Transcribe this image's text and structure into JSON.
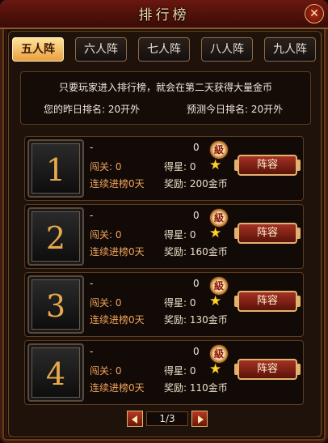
{
  "title": "排行榜",
  "close_label": "✕",
  "tabs": [
    {
      "label": "五人阵",
      "active": true
    },
    {
      "label": "六人阵",
      "active": false
    },
    {
      "label": "七人阵",
      "active": false
    },
    {
      "label": "八人阵",
      "active": false
    },
    {
      "label": "九人阵",
      "active": false
    }
  ],
  "info": {
    "notice": "只要玩家进入排行榜，就会在第二天获得大量金币",
    "yesterday_rank": "您的昨日排名: 20开外",
    "today_predict": "预测今日排名: 20开外"
  },
  "rows": [
    {
      "rank": "1",
      "name": "-",
      "level_value": "0",
      "level_badge": "級",
      "pass": "闯关: 0",
      "stars": "得星: 0",
      "streak": "连续进榜0天",
      "reward": "奖励: 200金币",
      "button": "阵容"
    },
    {
      "rank": "2",
      "name": "-",
      "level_value": "0",
      "level_badge": "級",
      "pass": "闯关: 0",
      "stars": "得星: 0",
      "streak": "连续进榜0天",
      "reward": "奖励: 160金币",
      "button": "阵容"
    },
    {
      "rank": "3",
      "name": "-",
      "level_value": "0",
      "level_badge": "級",
      "pass": "闯关: 0",
      "stars": "得星: 0",
      "streak": "连续进榜0天",
      "reward": "奖励: 130金币",
      "button": "阵容"
    },
    {
      "rank": "4",
      "name": "-",
      "level_value": "0",
      "level_badge": "級",
      "pass": "闯关: 0",
      "stars": "得星: 0",
      "streak": "连续进榜0天",
      "reward": "奖励: 110金币",
      "button": "阵容"
    }
  ],
  "pager": {
    "text": "1/3"
  },
  "colors": {
    "accent": "#e8a94b",
    "highlight_text": "#f2a45a",
    "button": "#a43224"
  },
  "icons": {
    "star": "star-icon",
    "level": "level-badge-icon",
    "close": "close-icon"
  }
}
